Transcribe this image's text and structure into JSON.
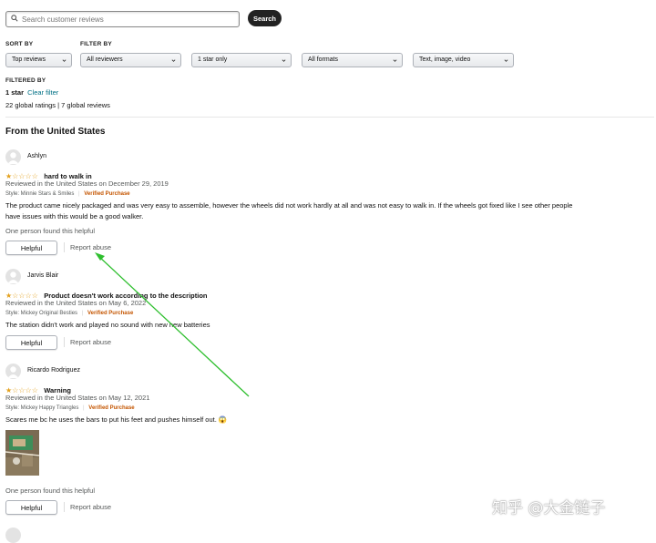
{
  "search": {
    "placeholder": "Search customer reviews",
    "button": "Search"
  },
  "sort": {
    "label": "SORT BY",
    "value": "Top reviews"
  },
  "filter": {
    "label": "FILTER BY",
    "reviewers": "All reviewers",
    "stars": "1 star only",
    "formats": "All formats",
    "media": "Text, image, video"
  },
  "filtered": {
    "label": "FILTERED BY",
    "value": "1 star",
    "clear": "Clear filter",
    "summary": "22 global ratings | 7 global reviews"
  },
  "section_title": "From the United States",
  "stars_glyph": "★☆☆☆☆",
  "reviews": [
    {
      "name": "Ashlyn",
      "title": "hard to walk in",
      "date": "Reviewed in the United States on December 29, 2019",
      "style": "Style: Minnie Stars & Smiles",
      "verified": "Verified Purchase",
      "body": "The product came nicely packaged and was very easy to assemble, however the wheels did not work hardly at all and was not easy to walk in. If the wheels got fixed like I see other people have issues with this would be a good walker.",
      "found": "One person found this helpful",
      "helpful": "Helpful",
      "report": "Report abuse"
    },
    {
      "name": "Jarvis Blair",
      "title": "Product doesn't work according to the description",
      "date": "Reviewed in the United States on May 6, 2022",
      "style": "Style: Mickey Original Besties",
      "verified": "Verified Purchase",
      "body": "The station didn't work and played no sound with new new batteries",
      "helpful": "Helpful",
      "report": "Report abuse"
    },
    {
      "name": "Ricardo Rodriguez",
      "title": "Warning",
      "date": "Reviewed in the United States on May 12, 2021",
      "style": "Style: Mickey Happy Triangles",
      "verified": "Verified Purchase",
      "body": "Scares me bc he uses the bars to put his feet and pushes himself out. 😱",
      "found": "One person found this helpful",
      "helpful": "Helpful",
      "report": "Report abuse"
    }
  ],
  "watermark": "知乎 @大金链子",
  "colors": {
    "arrow": "#2fbf2f",
    "link": "#007185",
    "verified": "#c45500",
    "star": "#e3a01c"
  }
}
